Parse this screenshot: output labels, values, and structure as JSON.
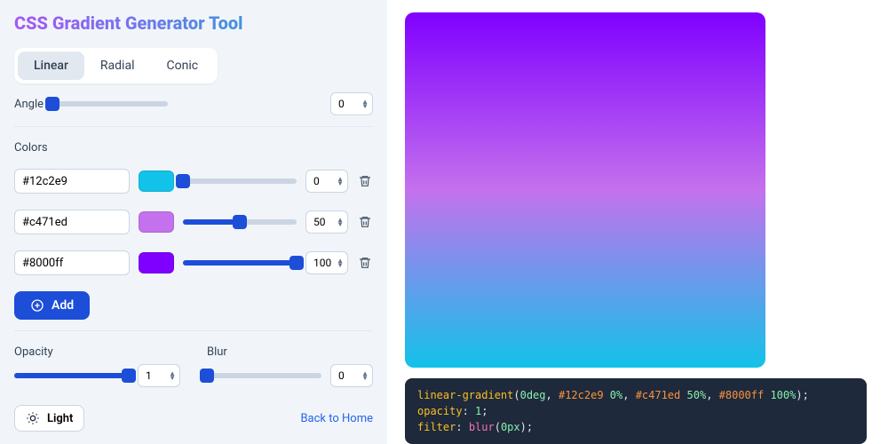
{
  "title": "CSS Gradient Generator Tool",
  "tabs": {
    "linear": "Linear",
    "radial": "Radial",
    "conic": "Conic",
    "active": "linear"
  },
  "angle": {
    "label": "Angle",
    "value": "0"
  },
  "colors_label": "Colors",
  "colors": [
    {
      "hex": "#12c2e9",
      "swatch": "#12c2e9",
      "pos": "0"
    },
    {
      "hex": "#c471ed",
      "swatch": "#c471ed",
      "pos": "50"
    },
    {
      "hex": "#8000ff",
      "swatch": "#8000ff",
      "pos": "100"
    }
  ],
  "add_label": "Add",
  "opacity": {
    "label": "Opacity",
    "value": "1"
  },
  "blur": {
    "label": "Blur",
    "value": "0"
  },
  "theme_label": "Light",
  "back_label": "Back to Home",
  "preview_gradient": "linear-gradient(0deg, #12c2e9 0%, #c471ed 50%, #8000ff 100%)",
  "code": {
    "fn": "linear-gradient",
    "angle": "0deg",
    "stops": [
      {
        "hex": "#12c2e9",
        "pct": "0%"
      },
      {
        "hex": "#c471ed",
        "pct": "50%"
      },
      {
        "hex": "#8000ff",
        "pct": "100%"
      }
    ],
    "opacity_key": "opacity",
    "opacity_val": "1",
    "filter_key": "filter",
    "blur_val": "0px"
  }
}
